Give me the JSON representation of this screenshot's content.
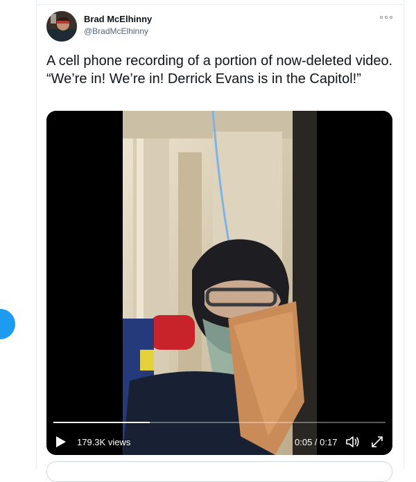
{
  "tweet": {
    "author_name": "Brad McElhinny",
    "author_handle": "@BradMcElhinny",
    "text": "A cell phone recording of a portion of now-deleted video. “We’re in! We’re in! Derrick Evans is in the Capitol!”",
    "more_icon": "more-horizontal-icon"
  },
  "video": {
    "views": "179.3K views",
    "timecode": "0:05 / 0:17",
    "progress_fraction": 0.29,
    "icons": [
      "play-icon",
      "volume-icon",
      "fullscreen-icon"
    ]
  },
  "colors": {
    "accent": "#1d9bf0",
    "text": "#0f1419",
    "secondary_text": "#536471",
    "border": "#e6ecf0"
  }
}
